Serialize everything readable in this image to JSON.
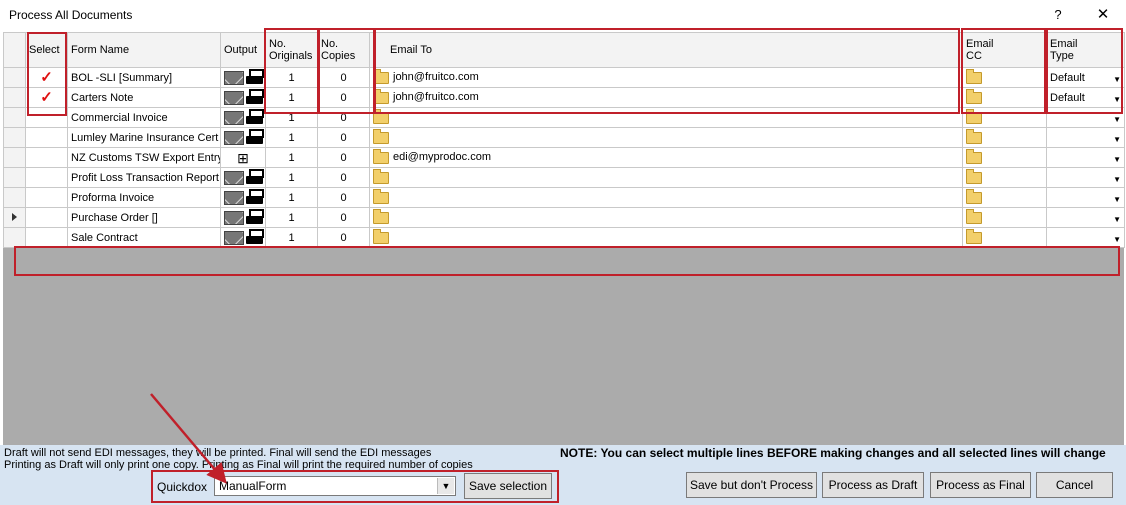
{
  "window": {
    "title": "Process All Documents",
    "help_label": "?",
    "close_label": "✕"
  },
  "grid": {
    "headers": {
      "select": "Select",
      "form_name": "Form Name",
      "output": "Output",
      "originals_1": "No.",
      "originals_2": "Originals",
      "copies_1": "No.",
      "copies_2": "Copies",
      "email_to": "Email To",
      "email_cc_1": "Email",
      "email_cc_2": "CC",
      "email_type_1": "Email",
      "email_type_2": "Type"
    },
    "rows": [
      {
        "selected": "✓",
        "form_name": "BOL -SLI [Summary]",
        "output": "email-print",
        "originals": "1",
        "copies": "0",
        "email_to": "john@fruitco.com",
        "email_type": "Default"
      },
      {
        "selected": "✓",
        "form_name": "Carters Note",
        "output": "email-print",
        "originals": "1",
        "copies": "0",
        "email_to": "john@fruitco.com",
        "email_type": "Default"
      },
      {
        "selected": "",
        "form_name": "Commercial Invoice",
        "output": "email-print",
        "originals": "1",
        "copies": "0",
        "email_to": "",
        "email_type": ""
      },
      {
        "selected": "",
        "form_name": "Lumley Marine Insurance Cert",
        "output": "email-print",
        "originals": "1",
        "copies": "0",
        "email_to": "",
        "email_type": ""
      },
      {
        "selected": "",
        "form_name": "NZ Customs TSW Export Entry",
        "output": "edi",
        "originals": "1",
        "copies": "0",
        "email_to": "edi@myprodoc.com",
        "email_type": ""
      },
      {
        "selected": "",
        "form_name": "Profit Loss Transaction Report",
        "output": "email-print",
        "originals": "1",
        "copies": "0",
        "email_to": "",
        "email_type": ""
      },
      {
        "selected": "",
        "form_name": "Proforma Invoice",
        "output": "email-print",
        "originals": "1",
        "copies": "0",
        "email_to": "",
        "email_type": ""
      },
      {
        "selected": "",
        "form_name": "Purchase Order []",
        "output": "email-print",
        "originals": "1",
        "copies": "0",
        "email_to": "",
        "email_type": ""
      },
      {
        "selected": "",
        "form_name": "Sale Contract",
        "output": "email-print",
        "originals": "1",
        "copies": "0",
        "email_to": "",
        "email_type": ""
      }
    ]
  },
  "footer": {
    "note_draft": "Draft will not send EDI messages, they will be printed.  Final will send the EDI messages",
    "note_print": "Printing as Draft will only print one copy.  Printing as Final will print the required number of copies",
    "note_bold": "NOTE:  You can select multiple lines BEFORE making changes and all selected lines will change",
    "quickdox_label": "Quickdox",
    "quickdox_value": "ManualForm",
    "save_selection": "Save selection",
    "save_no_process": "Save but don't Process",
    "process_draft": "Process as Draft",
    "process_final": "Process as Final",
    "cancel": "Cancel"
  },
  "colors": {
    "highlight_red": "#c0202a",
    "check_red": "#e01010",
    "footer_bg": "#d7e4f2",
    "grid_bg": "#ababab"
  }
}
